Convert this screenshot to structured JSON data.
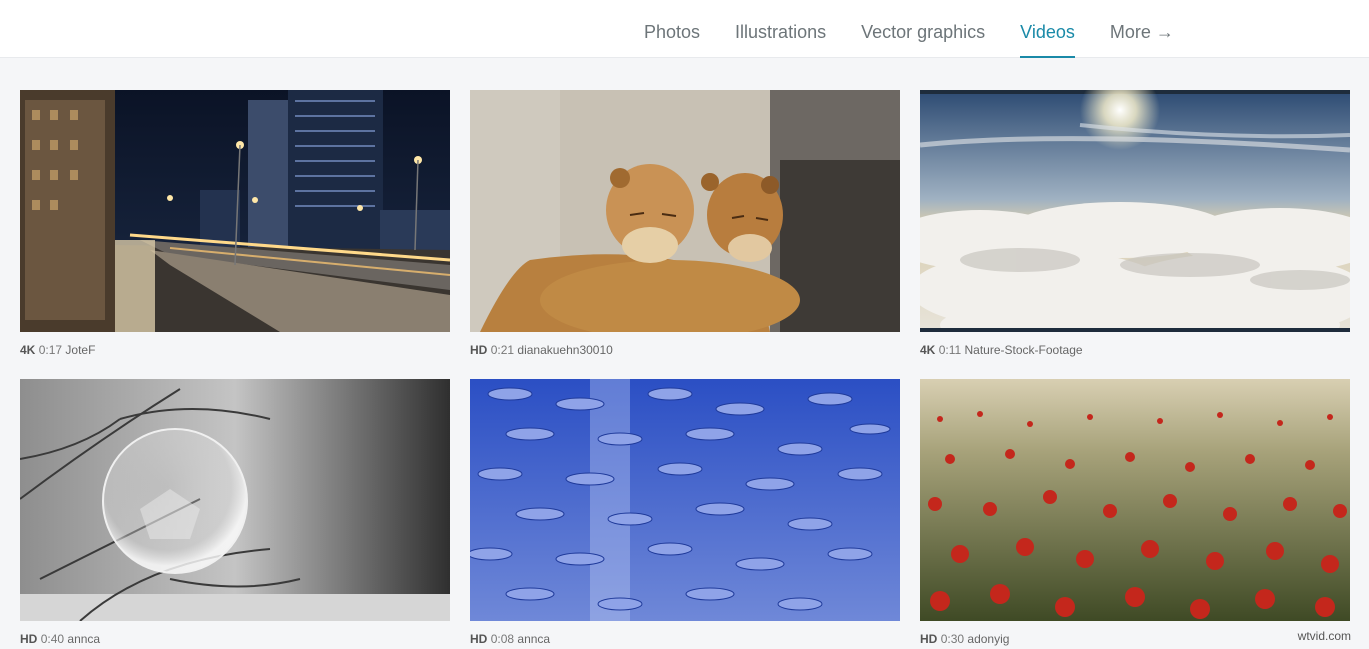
{
  "nav": {
    "items": [
      {
        "label": "Photos",
        "active": false
      },
      {
        "label": "Illustrations",
        "active": false
      },
      {
        "label": "Vector graphics",
        "active": false
      },
      {
        "label": "Videos",
        "active": true
      },
      {
        "label": "More →",
        "active": false
      }
    ]
  },
  "videos": [
    {
      "quality": "4K",
      "duration": "0:17",
      "user": "JoteF",
      "scene": "city-night"
    },
    {
      "quality": "HD",
      "duration": "0:21",
      "user": "dianakuehn30010",
      "scene": "lionesses"
    },
    {
      "quality": "4K",
      "duration": "0:11",
      "user": "Nature-Stock-Footage",
      "scene": "clouds"
    },
    {
      "quality": "HD",
      "duration": "0:40",
      "user": "annca",
      "scene": "frozen-bubble"
    },
    {
      "quality": "HD",
      "duration": "0:08",
      "user": "annca",
      "scene": "fish-school"
    },
    {
      "quality": "HD",
      "duration": "0:30",
      "user": "adonyig",
      "scene": "poppy-field"
    }
  ],
  "watermark": "wtvid.com",
  "colors": {
    "accent": "#1a8aa8",
    "nav_text": "#6d7579",
    "page_bg": "#f5f6f8"
  }
}
